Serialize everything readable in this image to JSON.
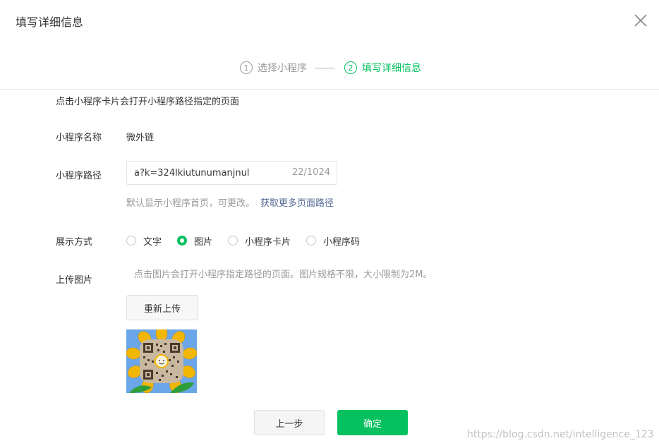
{
  "dialog": {
    "title": "填写详细信息",
    "close_icon": "close-icon"
  },
  "steps": [
    {
      "num": "1",
      "label": "选择小程序",
      "state": "inactive"
    },
    {
      "num": "2",
      "label": "填写详细信息",
      "state": "active"
    }
  ],
  "form": {
    "intro": "点击小程序卡片会打开小程序路径指定的页面",
    "name_label": "小程序名称",
    "name_value": "微外链",
    "path_label": "小程序路径",
    "path_value": "a?k=324lkiutunumanjnul",
    "path_counter": "22/1024",
    "path_hint": "默认显示小程序首页，可更改。",
    "path_link": "获取更多页面路径",
    "display_label": "展示方式",
    "display_options": [
      {
        "label": "文字",
        "checked": false
      },
      {
        "label": "图片",
        "checked": true
      },
      {
        "label": "小程序卡片",
        "checked": false
      },
      {
        "label": "小程序码",
        "checked": false
      }
    ],
    "upload_label": "上传图片",
    "upload_hint": "点击图片会打开小程序指定路径的页面。图片规格不限，大小限制为2M。",
    "reupload_label": "重新上传",
    "preview_image": "sunflower-qr-code-image"
  },
  "footer": {
    "prev_label": "上一步",
    "ok_label": "确定"
  },
  "watermark": "https://blog.csdn.net/intelligence_123",
  "colors": {
    "accent": "#07c160",
    "link": "#576b95",
    "muted": "#9a9a9a"
  }
}
